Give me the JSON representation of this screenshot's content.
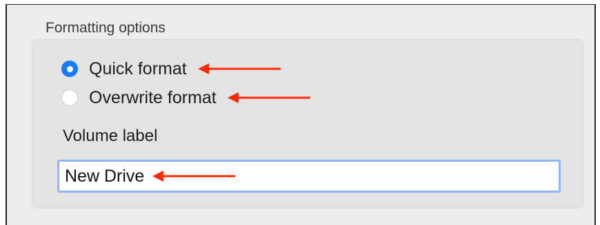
{
  "formatting_options": {
    "title": "Formatting options",
    "radios": [
      {
        "label": "Quick format",
        "selected": true
      },
      {
        "label": "Overwrite format",
        "selected": false
      }
    ]
  },
  "volume_label": {
    "label": "Volume label",
    "value": "New Drive"
  },
  "annotation": {
    "arrow_color": "#ff2a00",
    "arrows": [
      "arrow-left-icon",
      "arrow-left-icon",
      "arrow-left-icon"
    ]
  },
  "colors": {
    "accent": "#1a7cf4",
    "focus_ring": "#8fb6f0",
    "panel_bg": "#e3e3e3"
  }
}
